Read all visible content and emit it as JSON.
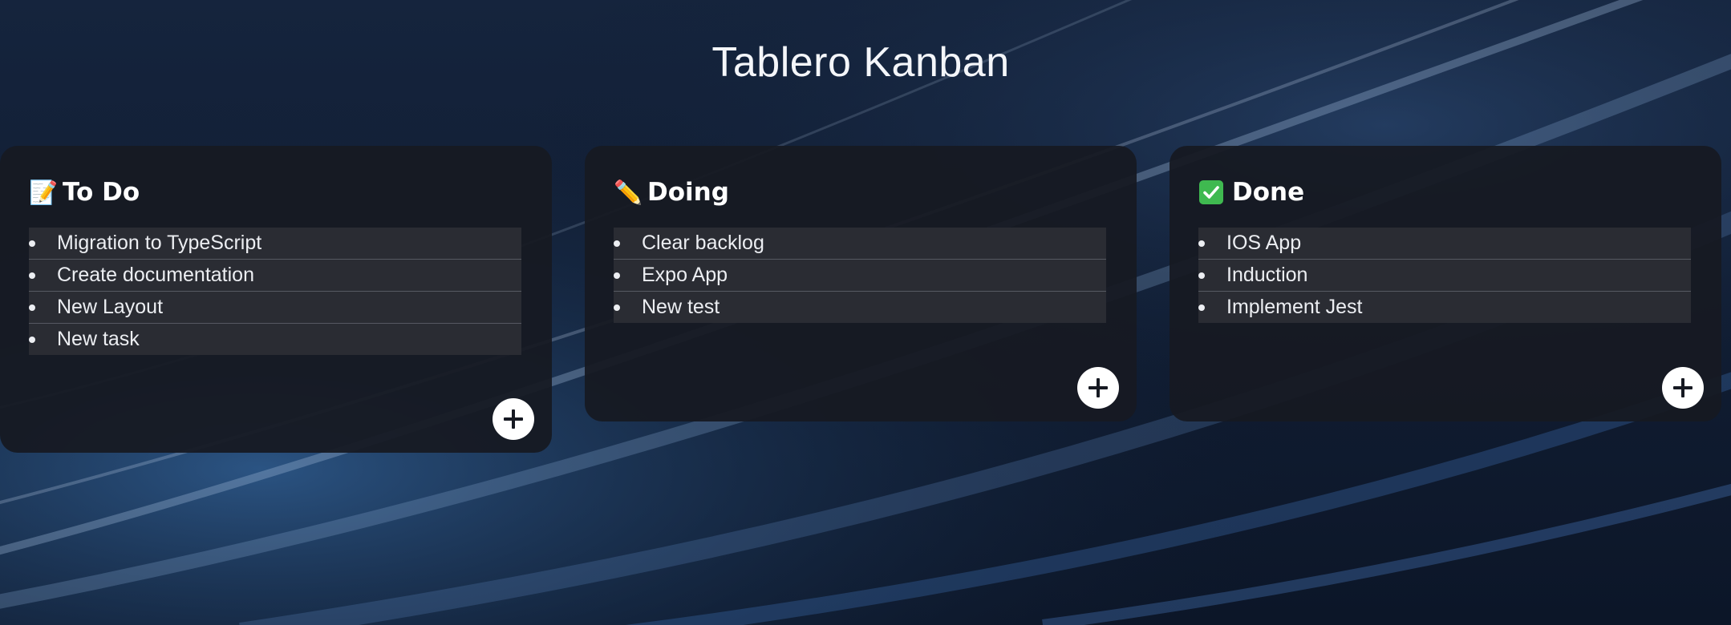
{
  "board": {
    "title": "Tablero Kanban"
  },
  "columns": [
    {
      "icon": "📝",
      "icon_name": "memo-icon",
      "title": "To Do",
      "tasks": [
        "Migration to TypeScript",
        "Create documentation",
        "New Layout",
        "New task"
      ]
    },
    {
      "icon": "✏️",
      "icon_name": "pencil-icon",
      "title": "Doing",
      "tasks": [
        "Clear backlog",
        "Expo App",
        "New test"
      ]
    },
    {
      "icon": "✅",
      "icon_name": "check-mark-icon",
      "title": "Done",
      "tasks": [
        "IOS App",
        "Induction",
        "Implement Jest"
      ]
    }
  ],
  "add_button_icon": "plus-icon",
  "colors": {
    "background": "#0f1b30",
    "column_bg": "#16192299",
    "task_bg": "#2a2c33",
    "add_button_bg": "#ffffff",
    "add_button_icon": "#161922",
    "done_icon": "#3fb950"
  }
}
